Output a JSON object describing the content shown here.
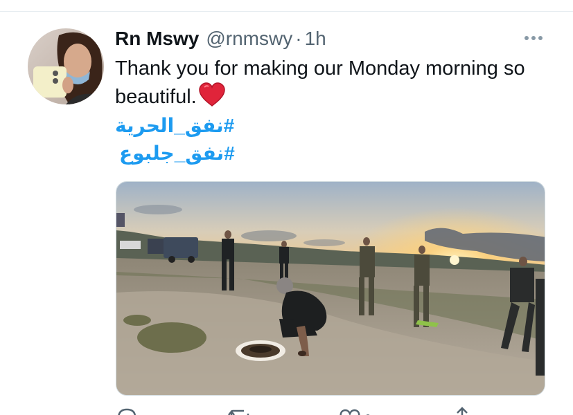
{
  "tweet": {
    "display_name": "Rn Mswy",
    "handle": "@rnmswy",
    "separator": "·",
    "time": "1h",
    "text": "Thank you for making our Monday morning so beautiful.",
    "hashtags": [
      "#نفق_الحرية",
      "#نفق_جلبوع"
    ]
  },
  "icons": {
    "more": "more-horizontal-icon",
    "heart": "red-heart-emoji",
    "reply": "reply-icon",
    "retweet": "retweet-icon",
    "like": "like-icon",
    "share": "share-icon"
  },
  "colors": {
    "text": "#0f1419",
    "secondary": "#536471",
    "link": "#1d9bf0",
    "heart": "#e0243a"
  }
}
